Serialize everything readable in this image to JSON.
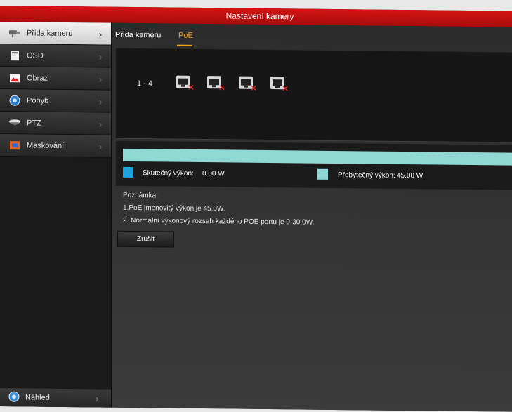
{
  "window": {
    "title": "Nastavení kamery"
  },
  "sidebar": {
    "items": [
      {
        "label": "Přida kameru",
        "icon": "camera-icon",
        "active": true
      },
      {
        "label": "OSD",
        "icon": "osd-icon",
        "active": false
      },
      {
        "label": "Obraz",
        "icon": "image-icon",
        "active": false
      },
      {
        "label": "Pohyb",
        "icon": "motion-icon",
        "active": false
      },
      {
        "label": "PTZ",
        "icon": "ptz-icon",
        "active": false
      },
      {
        "label": "Maskování",
        "icon": "mask-icon",
        "active": false
      }
    ],
    "bottom": {
      "label": "Náhled",
      "icon": "preview-icon"
    }
  },
  "tabs": [
    {
      "label": "Přida kameru",
      "active": false
    },
    {
      "label": "PoE",
      "active": true
    }
  ],
  "ports": {
    "range_label": "1 - 4",
    "items": [
      {
        "status": "disconnected"
      },
      {
        "status": "disconnected"
      },
      {
        "status": "disconnected"
      },
      {
        "status": "disconnected"
      }
    ]
  },
  "power": {
    "actual_label": "Skutečný výkon:",
    "actual_value": "0.00 W",
    "actual_color": "#1ea3dc",
    "surplus_label": "Přebytečný výkon:",
    "surplus_value": "45.00 W",
    "surplus_color": "#8fd8d4",
    "used_fraction": 0.0
  },
  "notes": {
    "heading": "Poznámka:",
    "line1": "1.PoE jmenovitý výkon je 45.0W.",
    "line2": "2. Normální výkonový rozsah každého POE portu je 0-30,0W."
  },
  "buttons": {
    "cancel": "Zrušit"
  }
}
